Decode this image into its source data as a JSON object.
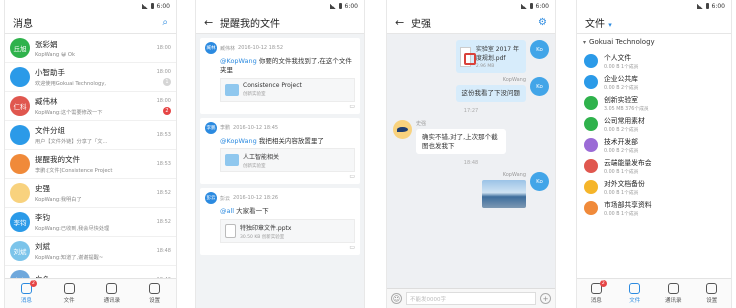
{
  "status": {
    "time": "6:00"
  },
  "screen1": {
    "title": "消息",
    "conversations": [
      {
        "avatar": "丘旭",
        "color": "#2fb24c",
        "name": "张彩娟",
        "preview": "KopWang 😀 Ok",
        "time": "18:00",
        "badge": ""
      },
      {
        "avatar": "",
        "color": "#2b9ae8",
        "name": "小智助手",
        "preview": "欢迎使用Gokuai Technology,",
        "time": "18:00",
        "badge": "1"
      },
      {
        "avatar": "仁科",
        "color": "#e0574f",
        "name": "臧伟林",
        "preview": "KopWang:这个需要修改一下",
        "time": "18:00",
        "badge": "2"
      },
      {
        "avatar": "",
        "color": "#2b9ae8",
        "name": "文件分组",
        "preview": "用户【文件外链】分享了「文...",
        "time": "18:53",
        "badge": ""
      },
      {
        "avatar": "",
        "color": "#f08a3a",
        "name": "提醒我的文件",
        "preview": "李鹏:[文件]Consistence Project",
        "time": "18:53",
        "badge": ""
      },
      {
        "avatar": "",
        "color": "#f8d27e",
        "name": "史强",
        "preview": "KopWang:我明白了",
        "time": "18:52",
        "badge": ""
      },
      {
        "avatar": "李钧",
        "color": "#2b9ae8",
        "name": "李钧",
        "preview": "KopWang:已收到,我会尽快处理",
        "time": "18:52",
        "badge": ""
      },
      {
        "avatar": "刘斌",
        "color": "#7cc4ea",
        "name": "刘斌",
        "preview": "KopWang:知道了,谢谢提醒~",
        "time": "18:48",
        "badge": ""
      },
      {
        "avatar": "白色",
        "color": "#6fa8dc",
        "name": "白色",
        "preview": "",
        "time": "18:46",
        "badge": ""
      }
    ],
    "tabs": [
      {
        "label": "消息",
        "badge": "2",
        "active": true
      },
      {
        "label": "文件",
        "badge": "",
        "active": false
      },
      {
        "label": "通讯录",
        "badge": "",
        "active": false
      },
      {
        "label": "设置",
        "badge": "",
        "active": false
      }
    ]
  },
  "screen2": {
    "title": "提醒我的文件",
    "cards": [
      {
        "avatar": "臧林",
        "user": "臧伟林",
        "date": "2016-10-12 18:52",
        "mention": "@KopWang",
        "text": " 你要的文件我找到了,在这个文件夹里",
        "file": "Consistence Project",
        "sub": "创新实验室",
        "type": "folder"
      },
      {
        "avatar": "李鹏",
        "user": "李鹏",
        "date": "2016-10-12 18:45",
        "mention": "@KopWang",
        "text": " 我把相关内容放置里了",
        "file": "人工智能相关",
        "sub": "创新实验室",
        "type": "folder"
      },
      {
        "avatar": "彭云",
        "user": "彭云",
        "date": "2016-10-12 18:26",
        "mention": "@all",
        "text": " 大家看一下",
        "file": "特独印章文件.pptx",
        "sub": "30.50 KB  创新实验室",
        "type": "doc"
      }
    ]
  },
  "screen3": {
    "title": "史强",
    "me_name": "KopWang",
    "me_avatar": "Ko",
    "pdf_name": "实验室 2017 年度规划.pdf",
    "pdf_size": "2.96 MB",
    "msg1": "这份我看了下没问题",
    "time1": "17:27",
    "other_name": "史强",
    "other_msg": "确实不错,对了,上次那个截图也发我下",
    "time2": "18:48",
    "input_placeholder": "不能发0000字"
  },
  "screen4": {
    "title": "文件",
    "section": "Gokuai Technology",
    "items": [
      {
        "name": "个人文件",
        "sub": "0.00 B   1个成员",
        "color": "#2b9ae8"
      },
      {
        "name": "企业公共库",
        "sub": "0.00 B   2个成员",
        "color": "#2b9ae8"
      },
      {
        "name": "创新实验室",
        "sub": "3.05 MB   376个成员",
        "color": "#2fb24c"
      },
      {
        "name": "公司常用素材",
        "sub": "0.00 B   2个成员",
        "color": "#2fb24c"
      },
      {
        "name": "技术开发部",
        "sub": "0.00 B   2个成员",
        "color": "#9b6bd6"
      },
      {
        "name": "云端能量发布会",
        "sub": "0.00 B   1个成员",
        "color": "#e0574f"
      },
      {
        "name": "对外文档备份",
        "sub": "0.00 B   1个成员",
        "color": "#f5b52a"
      },
      {
        "name": "市场部共享资料",
        "sub": "0.00 B   1个成员",
        "color": "#f08a3a"
      }
    ],
    "tabs": [
      {
        "label": "消息",
        "badge": "2",
        "active": false
      },
      {
        "label": "文件",
        "badge": "",
        "active": true
      },
      {
        "label": "通讯录",
        "badge": "",
        "active": false
      },
      {
        "label": "设置",
        "badge": "",
        "active": false
      }
    ]
  }
}
